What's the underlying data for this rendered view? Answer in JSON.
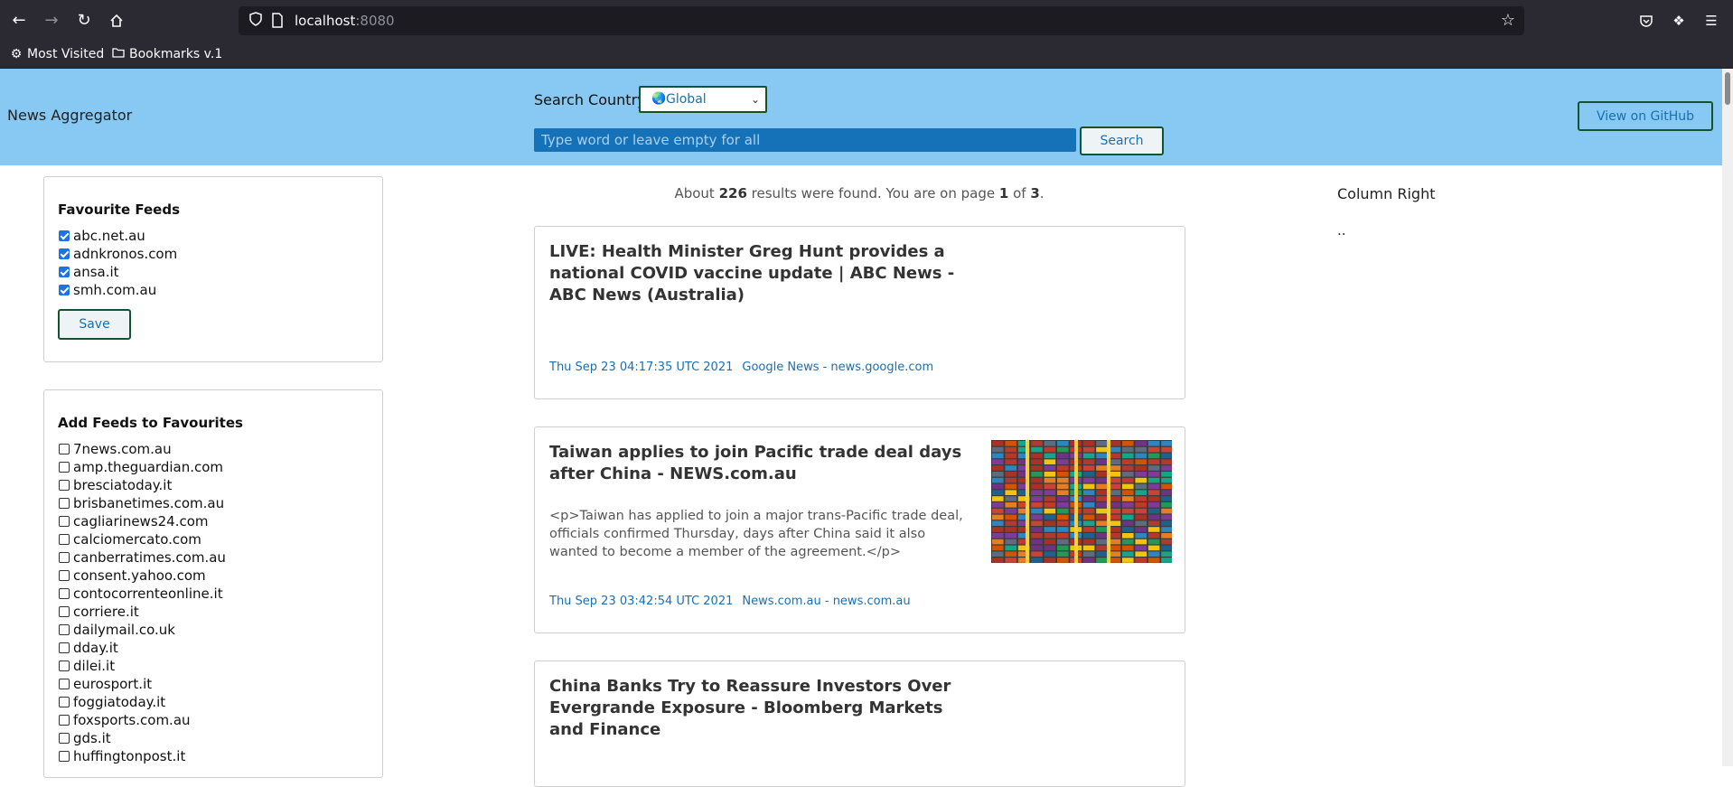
{
  "browser": {
    "url_host": "localhost",
    "url_port": ":8080",
    "bookmarks": [
      {
        "label": "Most Visited",
        "icon": "gear-icon"
      },
      {
        "label": "Bookmarks v.1",
        "icon": "folder-icon"
      }
    ]
  },
  "header": {
    "brand": "News Aggregator",
    "search_label": "Search Country:",
    "country_selected": "Global",
    "search_placeholder": "Type word or leave empty for all",
    "search_button": "Search",
    "github_button": "View on GitHub"
  },
  "favourites": {
    "title": "Favourite Feeds",
    "items": [
      {
        "label": "abc.net.au",
        "checked": true
      },
      {
        "label": "adnkronos.com",
        "checked": true
      },
      {
        "label": "ansa.it",
        "checked": true
      },
      {
        "label": "smh.com.au",
        "checked": true
      }
    ],
    "save_button": "Save"
  },
  "add_feeds": {
    "title": "Add Feeds to Favourites",
    "items": [
      {
        "label": "7news.com.au",
        "checked": false
      },
      {
        "label": "amp.theguardian.com",
        "checked": false
      },
      {
        "label": "bresciatoday.it",
        "checked": false
      },
      {
        "label": "brisbanetimes.com.au",
        "checked": false
      },
      {
        "label": "cagliarinews24.com",
        "checked": false
      },
      {
        "label": "calciomercato.com",
        "checked": false
      },
      {
        "label": "canberratimes.com.au",
        "checked": false
      },
      {
        "label": "consent.yahoo.com",
        "checked": false
      },
      {
        "label": "contocorrenteonline.it",
        "checked": false
      },
      {
        "label": "corriere.it",
        "checked": false
      },
      {
        "label": "dailymail.co.uk",
        "checked": false
      },
      {
        "label": "dday.it",
        "checked": false
      },
      {
        "label": "dilei.it",
        "checked": false
      },
      {
        "label": "eurosport.it",
        "checked": false
      },
      {
        "label": "foggiatoday.it",
        "checked": false
      },
      {
        "label": "foxsports.com.au",
        "checked": false
      },
      {
        "label": "gds.it",
        "checked": false
      },
      {
        "label": "huffingtonpost.it",
        "checked": false
      }
    ]
  },
  "results": {
    "prefix": "About ",
    "count": "226",
    "mid": " results were found. You are on page ",
    "page": "1",
    "of": " of ",
    "total_pages": "3",
    "suffix": "."
  },
  "articles": [
    {
      "title": "LIVE: Health Minister Greg Hunt provides a national COVID vaccine update | ABC News - ABC News (Australia)",
      "description": "",
      "date": "Thu Sep 23 04:17:35 UTC 2021",
      "source": "Google News - news.google.com",
      "has_image": false
    },
    {
      "title": "Taiwan applies to join Pacific trade deal days after China - NEWS.com.au",
      "description": "<p>Taiwan has applied to join a major trans-Pacific trade deal, officials confirmed Thursday, days after China said it also wanted to become a member of the agreement.</p>",
      "date": "Thu Sep 23 03:42:54 UTC 2021",
      "source": "News.com.au - news.com.au",
      "has_image": true
    },
    {
      "title": "China Banks Try to Reassure Investors Over Evergrande Exposure - Bloomberg Markets and Finance",
      "description": "",
      "date": "",
      "source": "",
      "has_image": false
    }
  ],
  "right_column": {
    "title": "Column Right",
    "placeholder": ".."
  }
}
